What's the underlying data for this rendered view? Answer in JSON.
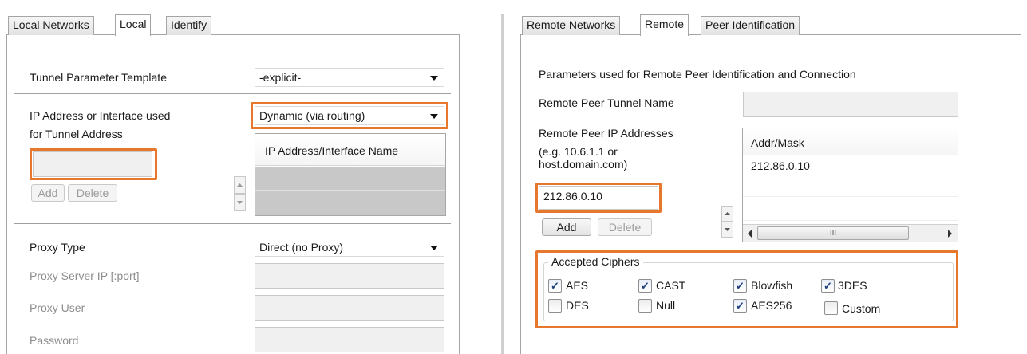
{
  "local_panel": {
    "tabs": [
      "Local Networks",
      "Local",
      "Identify"
    ],
    "active_tab": "Local",
    "tunnel_template_label": "Tunnel Parameter Template",
    "tunnel_template_value": "-explicit-",
    "ip_address_label_line1": "IP Address or Interface used",
    "ip_address_label_line2": "for Tunnel Address",
    "ip_address_mode_value": "Dynamic (via routing)",
    "ip_address_input_value": "",
    "add_label": "Add",
    "delete_label": "Delete",
    "interface_list_header": "IP Address/Interface Name",
    "interface_list_items": [],
    "proxy_type_label": "Proxy Type",
    "proxy_type_value": "Direct (no Proxy)",
    "proxy_server_label": "Proxy Server IP [:port]",
    "proxy_user_label": "Proxy User",
    "password_label": "Password"
  },
  "remote_panel": {
    "tabs": [
      "Remote Networks",
      "Remote",
      "Peer Identification"
    ],
    "active_tab": "Remote",
    "description": "Parameters used for Remote Peer Identification and Connection",
    "tunnel_name_label": "Remote Peer Tunnel Name",
    "tunnel_name_value": "",
    "ip_addresses_label": "Remote Peer IP Addresses",
    "ip_addresses_hint_line1": "(e.g. 10.6.1.1 or",
    "ip_addresses_hint_line2": "host.domain.com)",
    "ip_input_value": "212.86.0.10",
    "add_label": "Add",
    "delete_label": "Delete",
    "addr_list_header": "Addr/Mask",
    "addr_list_items": [
      "212.86.0.10"
    ],
    "scroll_grip": "III",
    "ciphers_group_label": "Accepted Ciphers",
    "ciphers": [
      {
        "name": "AES",
        "checked": true
      },
      {
        "name": "CAST",
        "checked": true
      },
      {
        "name": "Blowfish",
        "checked": true
      },
      {
        "name": "3DES",
        "checked": true
      },
      {
        "name": "DES",
        "checked": false
      },
      {
        "name": "Null",
        "checked": false
      },
      {
        "name": "AES256",
        "checked": true
      },
      {
        "name": "Custom",
        "checked": false
      }
    ]
  },
  "colors": {
    "highlight": "#e8772e",
    "tab_border": "#a5a5a5",
    "disabled_text": "#8d8d8d"
  }
}
